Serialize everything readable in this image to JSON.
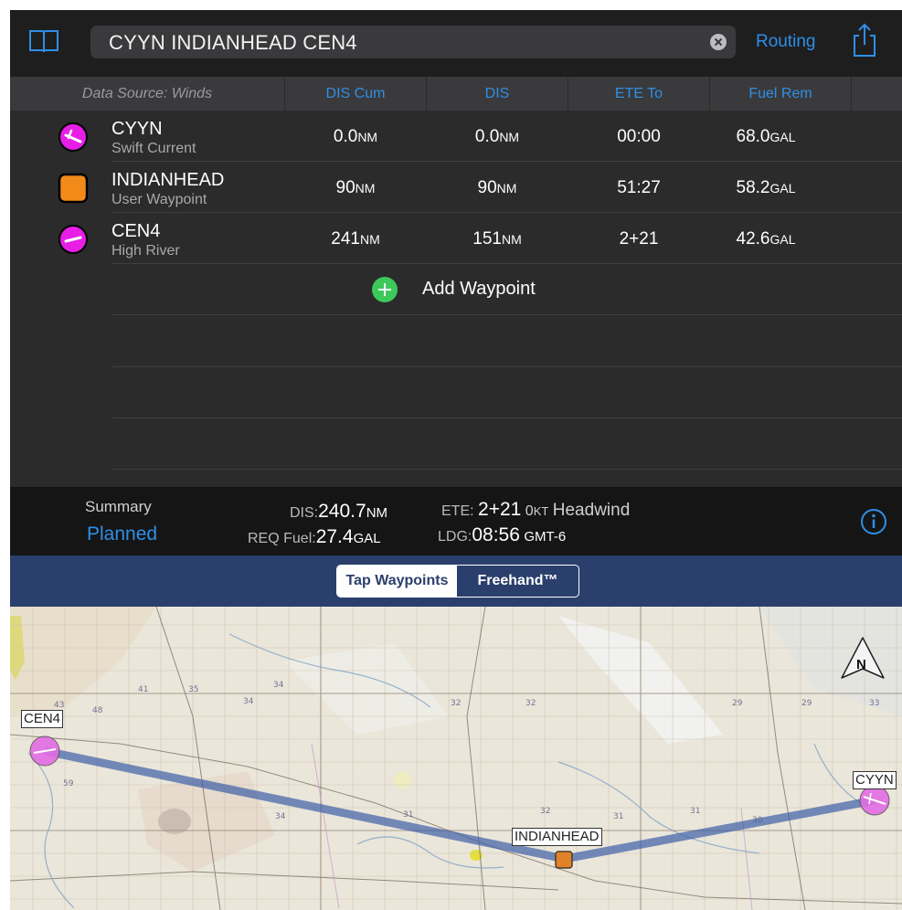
{
  "topbar": {
    "search_value": "CYYN INDIANHEAD CEN4",
    "routing_label": "Routing",
    "icons": {
      "book": "book-icon",
      "clear": "clear-icon",
      "share": "share-icon"
    }
  },
  "table": {
    "headers": {
      "source": "Data Source: Winds",
      "dis_cum": "DIS Cum",
      "dis": "DIS",
      "ete": "ETE To",
      "fuel": "Fuel Rem"
    },
    "waypoints": [
      {
        "name": "CYYN",
        "subtitle": "Swift Current",
        "icon": "airport-icon",
        "dis_cum": "0.0",
        "dis_cum_unit": "NM",
        "dis": "0.0",
        "dis_unit": "NM",
        "ete": "00:00",
        "fuel": "68.0",
        "fuel_unit": "GAL"
      },
      {
        "name": "INDIANHEAD",
        "subtitle": "User Waypoint",
        "icon": "user-waypoint-icon",
        "dis_cum": "90",
        "dis_cum_unit": "NM",
        "dis": "90",
        "dis_unit": "NM",
        "ete": "51:27",
        "fuel": "58.2",
        "fuel_unit": "GAL"
      },
      {
        "name": "CEN4",
        "subtitle": "High River",
        "icon": "airport-icon",
        "dis_cum": "241",
        "dis_cum_unit": "NM",
        "dis": "151",
        "dis_unit": "NM",
        "ete": "2+21",
        "fuel": "42.6",
        "fuel_unit": "GAL"
      }
    ],
    "add_label": "Add Waypoint"
  },
  "summary": {
    "title": "Summary",
    "mode": "Planned",
    "dis_label": "DIS:",
    "dis_value": "240.7",
    "dis_unit": "NM",
    "fuel_label": "REQ Fuel:",
    "fuel_value": "27.4",
    "fuel_unit": "GAL",
    "ete_label": "ETE:",
    "ete_value": "2+21",
    "wind_value": "0",
    "wind_unit": "KT",
    "wind_text": "Headwind",
    "ldg_label": "LDG:",
    "ldg_value": "08:56",
    "ldg_tz": "GMT-6"
  },
  "segment": {
    "tap_label": "Tap Waypoints",
    "free_label": "Freehand™",
    "selected": "Tap Waypoints"
  },
  "map": {
    "labels": {
      "cen4": "CEN4",
      "indianhead": "INDIANHEAD",
      "cyyn": "CYYN"
    },
    "north_label": "N"
  },
  "colors": {
    "accent": "#2f8fe6",
    "airport": "#e61ee6",
    "user_waypoint": "#f28a1a",
    "add_green": "#3cc95a",
    "route": "#3d5fa8"
  }
}
